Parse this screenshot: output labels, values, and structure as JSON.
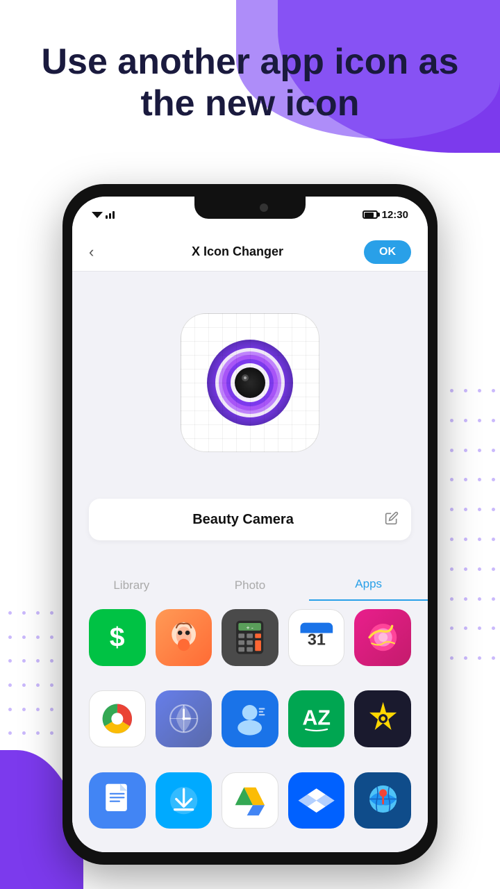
{
  "page": {
    "heading": "Use another app icon as the new icon",
    "background": {
      "accent_color": "#7c3aed"
    }
  },
  "status_bar": {
    "time": "12:30"
  },
  "nav": {
    "back_label": "‹",
    "title": "X Icon Changer",
    "ok_label": "OK"
  },
  "icon": {
    "app_name": "Beauty Camera"
  },
  "tabs": [
    {
      "id": "library",
      "label": "Library",
      "active": false
    },
    {
      "id": "photo",
      "label": "Photo",
      "active": false
    },
    {
      "id": "apps",
      "label": "Apps",
      "active": true
    }
  ],
  "apps": [
    {
      "id": "cashapp",
      "name": "Cash App",
      "color": "#00c244"
    },
    {
      "id": "toca",
      "name": "Toca Life",
      "color": "#ff6b35"
    },
    {
      "id": "calc",
      "name": "Calculator",
      "color": "#555555"
    },
    {
      "id": "calendar",
      "name": "Calendar",
      "color": "#ffffff"
    },
    {
      "id": "candy",
      "name": "Candy Crush",
      "color": "#c41c6c"
    },
    {
      "id": "chrome",
      "name": "Chrome",
      "color": "#ffffff"
    },
    {
      "id": "clock",
      "name": "Clock",
      "color": "#5a6aaa"
    },
    {
      "id": "contacts",
      "name": "Contacts",
      "color": "#1a73e8"
    },
    {
      "id": "alpha",
      "name": "Alpha",
      "color": "#00a651"
    },
    {
      "id": "superstar",
      "name": "Superstar",
      "color": "#1a1a2e"
    },
    {
      "id": "docs",
      "name": "Docs",
      "color": "#4285f4"
    },
    {
      "id": "downloader",
      "name": "Downloader",
      "color": "#00aaff"
    },
    {
      "id": "drive",
      "name": "Drive",
      "color": "#ffffff"
    },
    {
      "id": "dropbox",
      "name": "Dropbox",
      "color": "#0061ff"
    },
    {
      "id": "earth",
      "name": "Earth",
      "color": "#0f4c8a"
    }
  ]
}
